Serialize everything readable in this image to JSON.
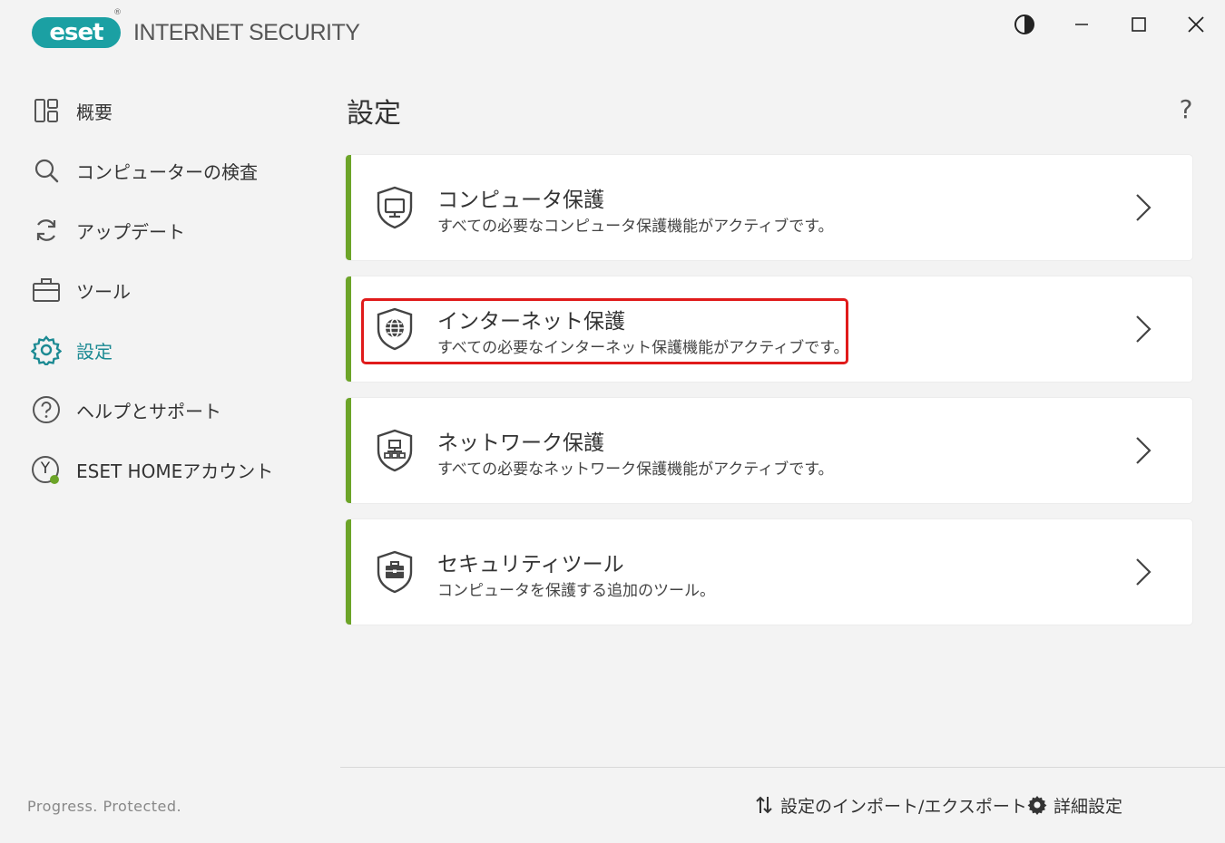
{
  "app": {
    "logo_text": "eset",
    "logo_reg": "®",
    "product_name": "INTERNET SECURITY"
  },
  "window_controls": {
    "theme_icon": "contrast-icon",
    "minimize_icon": "minimize-icon",
    "maximize_icon": "maximize-icon",
    "close_icon": "close-icon"
  },
  "sidebar": {
    "items": [
      {
        "label": "概要",
        "icon": "overview-icon"
      },
      {
        "label": "コンピューターの検査",
        "icon": "search-icon"
      },
      {
        "label": "アップデート",
        "icon": "update-icon"
      },
      {
        "label": "ツール",
        "icon": "toolbox-icon"
      },
      {
        "label": "設定",
        "icon": "gear-icon",
        "active": true
      },
      {
        "label": "ヘルプとサポート",
        "icon": "help-icon"
      },
      {
        "label": "ESET HOMEアカウント",
        "icon": "account-icon",
        "avatar_letter": "Y"
      }
    ],
    "tagline": "Progress. Protected."
  },
  "main": {
    "title": "設定",
    "help_label": "?",
    "cards": [
      {
        "title": "コンピュータ保護",
        "description": "すべての必要なコンピュータ保護機能がアクティブです。",
        "icon": "shield-monitor-icon"
      },
      {
        "title": "インターネット保護",
        "description": "すべての必要なインターネット保護機能がアクティブです。",
        "icon": "shield-globe-icon"
      },
      {
        "title": "ネットワーク保護",
        "description": "すべての必要なネットワーク保護機能がアクティブです。",
        "icon": "shield-network-icon"
      },
      {
        "title": "セキュリティツール",
        "description": "コンピュータを保護する追加のツール。",
        "icon": "shield-toolbox-icon"
      }
    ]
  },
  "footer": {
    "import_export_label": "設定のインポート/エクスポート",
    "advanced_label": "詳細設定"
  },
  "colors": {
    "brand_teal": "#1ba0a3",
    "active_teal": "#1c8a93",
    "status_green": "#6ca428",
    "highlight_red": "#e01b1b",
    "background": "#f3f3f3"
  }
}
